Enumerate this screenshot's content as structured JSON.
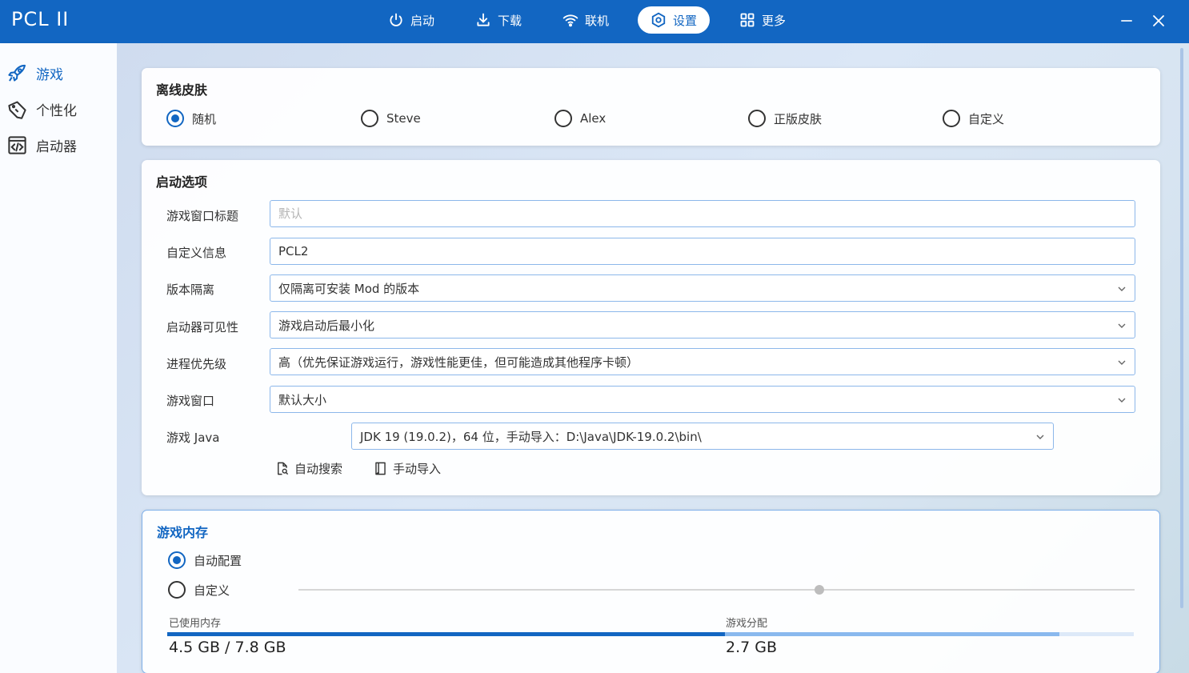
{
  "app": {
    "title": "PCL II"
  },
  "nav": {
    "launch": "启动",
    "download": "下载",
    "online": "联机",
    "settings": "设置",
    "more": "更多"
  },
  "sidebar": {
    "items": [
      {
        "label": "游戏",
        "icon": "rocket-icon",
        "active": true
      },
      {
        "label": "个性化",
        "icon": "brush-icon",
        "active": false
      },
      {
        "label": "启动器",
        "icon": "code-window-icon",
        "active": false
      }
    ]
  },
  "skin": {
    "title": "离线皮肤",
    "options": [
      "随机",
      "Steve",
      "Alex",
      "正版皮肤",
      "自定义"
    ],
    "selected": "随机"
  },
  "launch_options": {
    "title": "启动选项",
    "window_title_label": "游戏窗口标题",
    "window_title_placeholder": "默认",
    "custom_info_label": "自定义信息",
    "custom_info_value": "PCL2",
    "isolation_label": "版本隔离",
    "isolation_value": "仅隔离可安装 Mod 的版本",
    "visibility_label": "启动器可见性",
    "visibility_value": "游戏启动后最小化",
    "priority_label": "进程优先级",
    "priority_value": "高（优先保证游戏运行，游戏性能更佳，但可能造成其他程序卡顿）",
    "window_label": "游戏窗口",
    "window_value": "默认大小",
    "java_label": "游戏 Java",
    "java_value": "JDK 19 (19.0.2)，64 位，手动导入：D:\\Java\\JDK-19.0.2\\bin\\",
    "auto_search": "自动搜索",
    "manual_import": "手动导入"
  },
  "memory": {
    "title": "游戏内存",
    "auto_label": "自动配置",
    "custom_label": "自定义",
    "selected": "自动配置",
    "used_label": "已使用内存",
    "used_value": "4.5 GB / 7.8 GB",
    "alloc_label": "游戏分配",
    "alloc_value": "2.7 GB",
    "used_gb": 4.5,
    "total_gb": 7.8,
    "alloc_gb": 2.7,
    "slider_fraction": 0.623
  },
  "colors": {
    "accent": "#1266c2",
    "accent_light": "#8ab9ee"
  }
}
